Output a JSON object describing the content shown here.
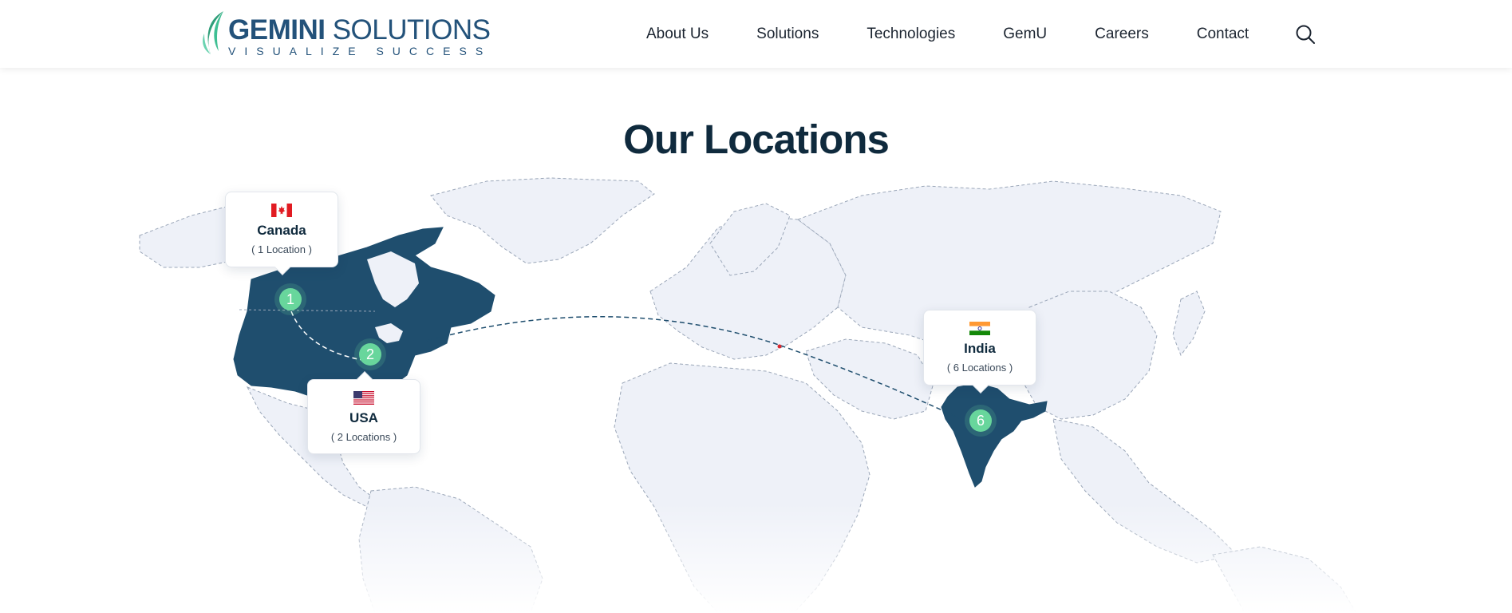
{
  "brand": {
    "name_strong": "GEMINI",
    "name_light": "SOLUTIONS",
    "tagline": "VISUALIZE SUCCESS"
  },
  "nav": {
    "items": [
      "About Us",
      "Solutions",
      "Technologies",
      "GemU",
      "Careers",
      "Contact"
    ],
    "search_icon": "search-icon"
  },
  "section": {
    "title": "Our Locations"
  },
  "locations": [
    {
      "country": "Canada",
      "count": "( 1 Location )",
      "pin": "1",
      "flag": "canada-flag-icon"
    },
    {
      "country": "USA",
      "count": "( 2 Locations )",
      "pin": "2",
      "flag": "usa-flag-icon"
    },
    {
      "country": "India",
      "count": "( 6 Locations )",
      "pin": "6",
      "flag": "india-flag-icon"
    }
  ],
  "colors": {
    "brand_blue": "#23527a",
    "highlight_country": "#1f4e6e",
    "pin_green": "#68d69c",
    "map_land": "#eef1f8",
    "map_border": "#9aa6b8"
  }
}
